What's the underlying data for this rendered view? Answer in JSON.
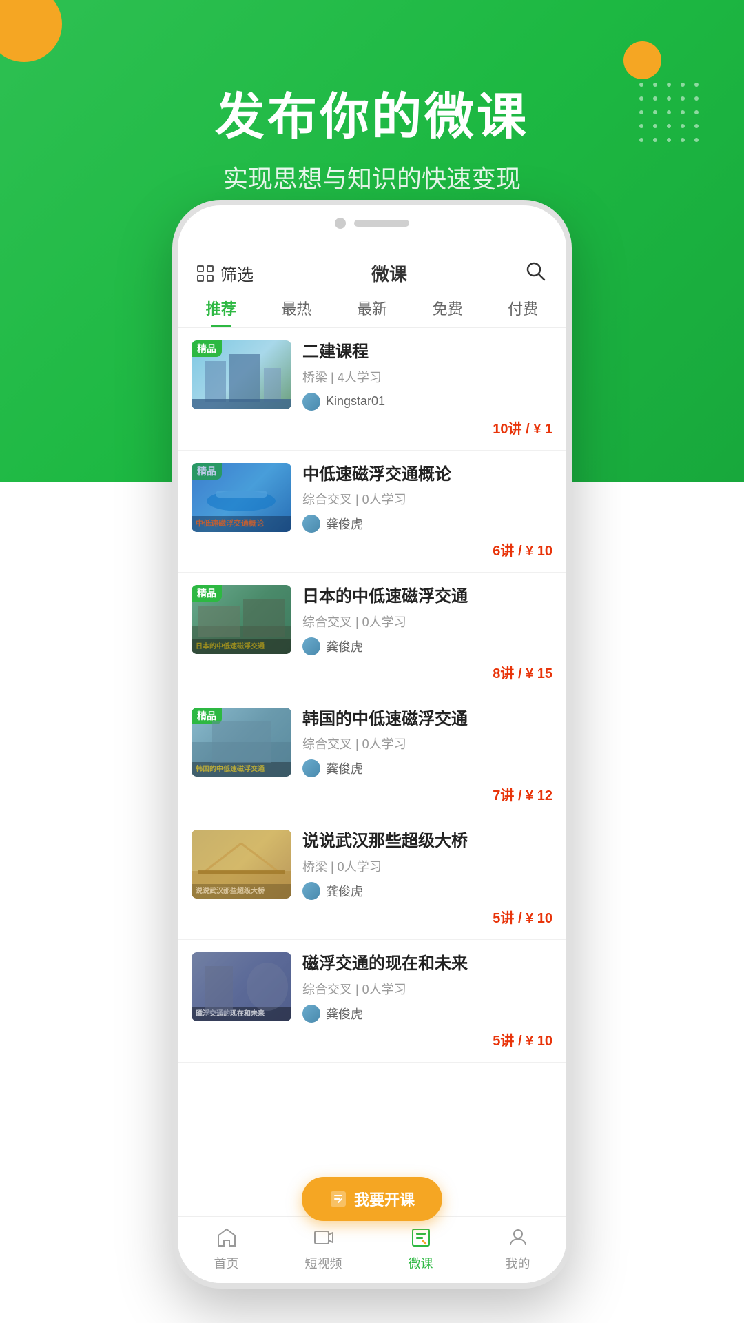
{
  "background": {
    "color": "#2ec052"
  },
  "header": {
    "title": "发布你的微课",
    "subtitle": "实现思想与知识的快速变现"
  },
  "topbar": {
    "filter_label": "筛选",
    "page_title": "微课"
  },
  "tabs": [
    {
      "id": "recommend",
      "label": "推荐",
      "active": true
    },
    {
      "id": "hot",
      "label": "最热",
      "active": false
    },
    {
      "id": "latest",
      "label": "最新",
      "active": false
    },
    {
      "id": "free",
      "label": "免费",
      "active": false
    },
    {
      "id": "paid",
      "label": "付费",
      "active": false
    }
  ],
  "courses": [
    {
      "id": 1,
      "badge": "精品",
      "name": "二建课程",
      "meta": "桥梁 | 4人学习",
      "author": "Kingstar01",
      "price": "10讲 / ¥ 1",
      "thumb_text": "",
      "thumb_class": "thumb-1"
    },
    {
      "id": 2,
      "badge": "精品",
      "name": "中低速磁浮交通概论",
      "meta": "综合交叉 | 0人学习",
      "author": "龚俊虎",
      "price": "6讲 / ¥ 10",
      "thumb_text": "中低速磁浮交通概论",
      "thumb_class": "thumb-2"
    },
    {
      "id": 3,
      "badge": "精品",
      "name": "日本的中低速磁浮交通",
      "meta": "综合交叉 | 0人学习",
      "author": "龚俊虎",
      "price": "8讲 / ¥ 15",
      "thumb_text": "日本的中低速磁浮交通",
      "thumb_class": "thumb-3"
    },
    {
      "id": 4,
      "badge": "精品",
      "name": "韩国的中低速磁浮交通",
      "meta": "综合交叉 | 0人学习",
      "author": "龚俊虎",
      "price": "7讲 / ¥ 12",
      "thumb_text": "韩国的中低速磁浮交通",
      "thumb_class": "thumb-4"
    },
    {
      "id": 5,
      "badge": "",
      "name": "说说武汉那些超级大桥",
      "meta": "桥梁 | 0人学习",
      "author": "龚俊虎",
      "price": "5讲 / ¥ 10",
      "thumb_text": "说说武汉那些超级大桥",
      "thumb_class": "thumb-5"
    },
    {
      "id": 6,
      "badge": "",
      "name": "磁浮交通的现在和未来",
      "meta": "综合交叉 | 0人学习",
      "author": "龚俊虎",
      "price": "5讲 / ¥ 10",
      "thumb_text": "磁浮交通的现在和未来",
      "thumb_class": "thumb-6"
    }
  ],
  "float_button": {
    "label": "我要开课"
  },
  "bottom_nav": [
    {
      "id": "home",
      "label": "首页",
      "active": false,
      "icon": "home-icon"
    },
    {
      "id": "video",
      "label": "短视频",
      "active": false,
      "icon": "video-icon"
    },
    {
      "id": "micro",
      "label": "微课",
      "active": true,
      "icon": "book-icon"
    },
    {
      "id": "mine",
      "label": "我的",
      "active": false,
      "icon": "user-icon"
    }
  ]
}
